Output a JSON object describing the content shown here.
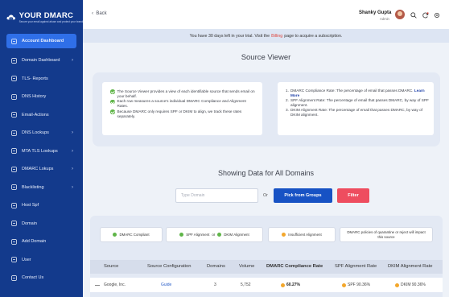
{
  "brand": {
    "name": "YOUR DMARC",
    "tagline": "Secure your email against abuse and protect your brand"
  },
  "sidebar": {
    "items": [
      {
        "label": "Account Dashboard",
        "icon": "dashboard-icon",
        "active": true,
        "has_submenu": false
      },
      {
        "label": "Domain Dashboard",
        "icon": "domain-dashboard-icon",
        "active": false,
        "has_submenu": true
      },
      {
        "label": "TLS- Reports",
        "icon": "report-icon",
        "active": false,
        "has_submenu": false
      },
      {
        "label": "DNS History",
        "icon": "history-icon",
        "active": false,
        "has_submenu": false
      },
      {
        "label": "Email-Actions",
        "icon": "email-icon",
        "active": false,
        "has_submenu": false
      },
      {
        "label": "DNS Lookups",
        "icon": "lookup-icon",
        "active": false,
        "has_submenu": true
      },
      {
        "label": "MTA TLS Lookups",
        "icon": "lookup-icon",
        "active": false,
        "has_submenu": true
      },
      {
        "label": "DMARC Lokups",
        "icon": "lookup-icon",
        "active": false,
        "has_submenu": true
      },
      {
        "label": "Blacklisting",
        "icon": "shield-icon",
        "active": false,
        "has_submenu": true
      },
      {
        "label": "Host Spf",
        "icon": "host-icon",
        "active": false,
        "has_submenu": false
      },
      {
        "label": "Domain",
        "icon": "globe-icon",
        "active": false,
        "has_submenu": false
      },
      {
        "label": "Add Domain",
        "icon": "add-domain-icon",
        "active": false,
        "has_submenu": false
      },
      {
        "label": "User",
        "icon": "user-icon",
        "active": false,
        "has_submenu": false
      },
      {
        "label": "Contact Us",
        "icon": "contact-icon",
        "active": false,
        "has_submenu": false
      }
    ]
  },
  "topbar": {
    "back_label": "Back",
    "user_name": "Shanky Gupta",
    "user_role": "Admin"
  },
  "banner": {
    "text_before": "You have 30 days left in your trial. Visit the",
    "link_text": "Billing",
    "text_after": "page to acquire a subscription."
  },
  "source_viewer": {
    "title": "Source Viewer",
    "left_points": [
      "The Source Viewer provides a view of each identifiable source that sends email on your behalf.",
      "Each row measures a source's individual DMARC Compliance and Alignment Rates.",
      "Because DMARC only requires SPF or DKIM to align, we track these rates separately."
    ],
    "right_points": [
      {
        "num": "1.",
        "text": "DMARC Compliance Rate: The percentage of email that passes DMARC.",
        "link": "Learn More"
      },
      {
        "num": "2.",
        "text": "SPF Alignment Rate: The percentage of email that passes DMARC, by way of SPF alignment.",
        "link": ""
      },
      {
        "num": "3.",
        "text": "DKIM Alignment Rate: The percentage of email that passes DMARC, by way of DKIM alignment.",
        "link": ""
      }
    ]
  },
  "filter": {
    "title": "Showing Data for All Domains",
    "input_placeholder": "Type Domain",
    "or_label": "Or",
    "pick_groups_label": "Pick from Groups",
    "filter_label": "Filter"
  },
  "legend": {
    "compliant": "DMARC Compliant",
    "spf": "SPF Alignment",
    "or": "or",
    "dkim": "DKIM Alignment",
    "insufficient": "Insufficient Alignment",
    "note": "DMARC policies of quarantine or reject will impact this source"
  },
  "table": {
    "headers": [
      "Source",
      "Source Configuration",
      "Domains",
      "Volume",
      "DMARC Compliance Rate",
      "SPF Alignment Rate",
      "DKIM Alignment Rate"
    ],
    "rows": [
      {
        "source": "Google, Inc.",
        "config": "Guide",
        "domains": "3",
        "volume": "5,752",
        "dmarc_rate": "60.27%",
        "spf_rate": "SPF 90.36%",
        "dkim_rate": "DKIM 90.36%"
      }
    ]
  },
  "colors": {
    "sidebar": "#133a8c",
    "accent": "#2f6fe8",
    "primary_button": "#1752c4",
    "filter_button": "#ee4d5f",
    "compliant": "#5fb548",
    "warning": "#f3a72c"
  }
}
